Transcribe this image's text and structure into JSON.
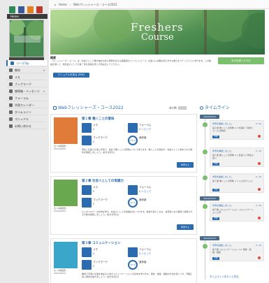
{
  "sidebar": {
    "topicon_colors": [
      "#2e8b57",
      "#3b5998",
      "#e67e22",
      "#c0392b"
    ],
    "home_label": "Home",
    "items": [
      {
        "label": "コースTop",
        "icon": "edit-icon",
        "active": true
      },
      {
        "label": "教材",
        "icon": "book-icon",
        "caret": true
      },
      {
        "label": "メモ",
        "icon": "memo-icon"
      },
      {
        "label": "ブックマーク",
        "icon": "bookmark-icon"
      },
      {
        "label": "質問箱・メッセージ",
        "icon": "chat-icon",
        "caret": true
      },
      {
        "label": "フォーラム",
        "icon": "forum-icon"
      },
      {
        "label": "学習カレンダー",
        "icon": "calendar-icon"
      },
      {
        "label": "タイムライン",
        "icon": "timeline-icon"
      },
      {
        "label": "マニュアル",
        "icon": "manual-icon"
      },
      {
        "label": "お問い合わせ",
        "icon": "mail-icon"
      }
    ]
  },
  "topbar": {
    "home": "Home",
    "course": "Webフレッシャーズ・コース2022"
  },
  "banner": {
    "title": "Freshers",
    "subtitle": "Course"
  },
  "overview": {
    "heading": "概要",
    "text": "「フレッシャーズ・コース」は、社会人として働き始める新人研修を支える講座型のインプットコース。社会人に必要な考え方や心構えをステップごとに学びます。この動画を通して、新社会人としての第一歩を自信を持って踏み出してください。"
  },
  "buttons": {
    "progress": "次の学習へすすむ",
    "manual": "マニュアルを見る (PDF)"
  },
  "section": {
    "title": "Webフレッシャーズ・コース2022",
    "sort_label": "並び順:"
  },
  "cards": [
    {
      "title": "第１章 働くことの意味",
      "caption": "全 16講座数 / 2022/04/01",
      "memo_label": "メモ",
      "memo_value": "0",
      "forum_label": "フォーラム",
      "forum_value": "0 トピック",
      "bookmark_label": "ブックマーク",
      "bookmark_value": "0",
      "progress_label": "進捗度",
      "progress_value": "24 %",
      "desc": "学生と社会人の違いを知り、会社で働くことの意味について考えます。働くことの目的や、社会人として求められる姿勢を確認しましょう。[続きを見る]",
      "button": "学習する",
      "img_color": "#e07b39"
    },
    {
      "title": "第２章 社会人としての常識力",
      "caption": "全 10講座数 / 2022/04/01",
      "memo_label": "メモ",
      "memo_value": "0",
      "forum_label": "フォーラム",
      "forum_value": "0 トピック",
      "bookmark_label": "ブックマーク",
      "bookmark_value": "0",
      "progress_label": "進捗度",
      "progress_value": "10 %",
      "desc": "ビジネスマナーの基本を学び、社会人としての常識を身につけます。挨拶や身だしなみ、言葉遣いなど職場で信頼される行動を確認しましょう。[続きを見る]",
      "button": "学習する",
      "img_color": "#6aa84f"
    },
    {
      "title": "第３章 コミュニケーション",
      "caption": "全 12講座数 / 2022/04/01",
      "memo_label": "メモ",
      "memo_value": "0",
      "forum_label": "フォーラム",
      "forum_value": "0 トピック",
      "bookmark_label": "ブックマーク",
      "bookmark_value": "0",
      "progress_label": "進捗度",
      "progress_value": "10 %",
      "desc": "職場で円滑に仕事を進めるためのコミュニケーションの基本を学びます。報告・連絡・相談の方法を身につけ、周囲と良い関係を築きましょう。[続きを見る]",
      "button": "学習する",
      "img_color": "#3aa6c9"
    }
  ],
  "timeline": {
    "title": "タイムライン",
    "more": "タイムラインをもっと見る",
    "groups": [
      {
        "date": "2022/03/24",
        "items": [
          {
            "title": "学習を開始しました。",
            "time": "0 :10",
            "body": "第１章 働くことの意味 1.2 仕事の「目的とゴールの関係」",
            "tag": "学習"
          },
          {
            "title": "学習を開始しました。",
            "time": "0 :10",
            "body": "第１章 働くことの意味 1.1 社会人と学生の違い",
            "tag": "学習"
          },
          {
            "title": "学習を開始しました。",
            "time": "0 :10",
            "body": "第１章 働くことの意味 イントロダクション",
            "tag": "学習"
          }
        ]
      },
      {
        "date": "2022/03/23",
        "items": [
          {
            "title": "学習を開始しました。",
            "time": "0 :10",
            "body": "第３章 コミュニケーション コミュニケーション入門",
            "tag": "学習"
          }
        ]
      },
      {
        "date": "2022/03/23",
        "items": [
          {
            "title": "学習を開始しました。",
            "time": "0 :10",
            "body": "第３章 コミュニケーション 3.1 報告・連絡・相談",
            "tag": "学習"
          }
        ]
      }
    ]
  }
}
